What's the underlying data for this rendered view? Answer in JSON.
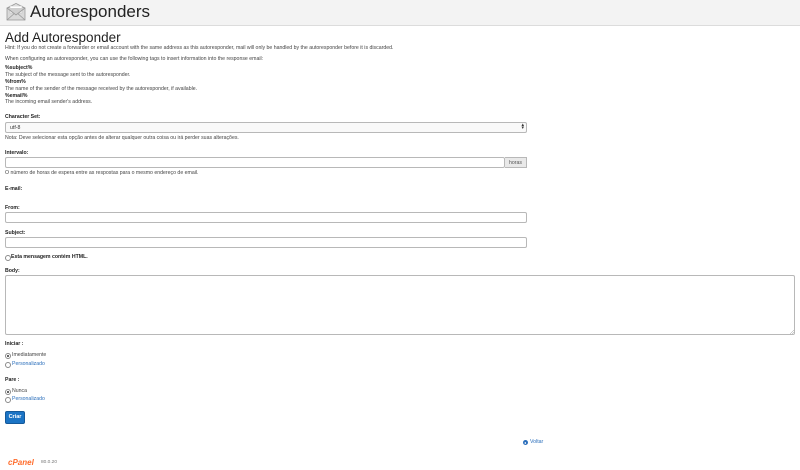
{
  "header": {
    "title": "Autoresponders",
    "icon": "envelope-icon"
  },
  "page": {
    "heading": "Add Autoresponder",
    "hint": "Hint: If you do not create a forwarder or email account with the same address as this autoresponder, mail will only be handled by the autoresponder before it is discarded.",
    "tags_intro": "When configuring an autoresponder, you can use the following tags to insert information into the response email:",
    "tags": [
      {
        "tag": "%subject%",
        "desc": "The subject of the message sent to the autoresponder."
      },
      {
        "tag": "%from%",
        "desc": "The name of the sender of the message received by the autoresponder, if available."
      },
      {
        "tag": "%email%",
        "desc": "The incoming email sender's address."
      }
    ]
  },
  "form": {
    "charset": {
      "label": "Character Set:",
      "value": "utf-8",
      "note": "Nota: Deve selecionar esta opção antes de alterar qualquer outra coisa ou irá perder suas alterações."
    },
    "interval": {
      "label": "Intervalo:",
      "value": "",
      "addon": "horas",
      "help": "O número de horas de espera entre as respostas para o mesmo endereço de email."
    },
    "email": {
      "label": "E-mail:"
    },
    "from": {
      "label": "From:",
      "value": ""
    },
    "subject": {
      "label": "Subject:",
      "value": ""
    },
    "html_checkbox": {
      "label": "Esta mensagem contém HTML.",
      "checked": false
    },
    "body": {
      "label": "Body:",
      "value": ""
    },
    "start": {
      "label": "Iniciar :",
      "options": [
        "Imediatamente",
        "Personalizado"
      ],
      "selected": "Imediatamente"
    },
    "stop": {
      "label": "Pare :",
      "options": [
        "Nunca",
        "Personalizado"
      ],
      "selected": "Nunca"
    },
    "submit_label": "Criar"
  },
  "footer": {
    "back_label": "Voltar",
    "logo": "cPanel",
    "version": "80.0.20"
  },
  "colors": {
    "primary_button": "#1b74c5",
    "link": "#2a6ebb",
    "logo": "#ff6c2c"
  }
}
